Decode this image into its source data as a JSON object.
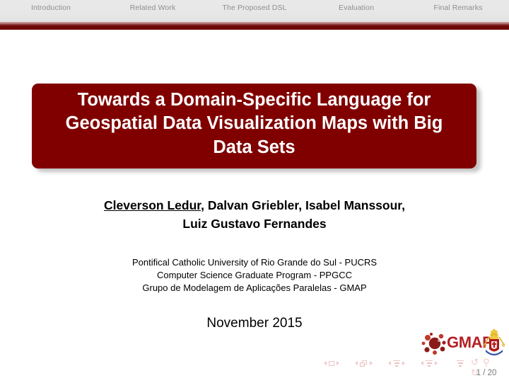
{
  "header": {
    "nav_items": [
      {
        "label": "Introduction"
      },
      {
        "label": "Related Work"
      },
      {
        "label": "The Proposed DSL"
      },
      {
        "label": "Evaluation"
      },
      {
        "label": "Final Remarks"
      }
    ],
    "accent_color": "#6d0606",
    "bar_background": "#e7e7e7",
    "nav_text_color": "#8e8e8e"
  },
  "slide": {
    "title": "Towards a Domain-Specific Language for Geospatial Data Visualization Maps with Big Data Sets",
    "title_box_color": "#800000",
    "title_text_color": "#ffffff",
    "authors": {
      "presenter": "Cleverson Ledur",
      "line1_rest": ", Dalvan Griebler, Isabel Manssour,",
      "line2": "Luiz Gustavo Fernandes"
    },
    "affiliation": [
      "Pontifical Catholic University of Rio Grande do Sul - PUCRS",
      "Computer Science Graduate Program - PPGCC",
      "Grupo de Modelagem de Aplicações Paralelas - GMAP"
    ],
    "date": "November 2015"
  },
  "logo": {
    "name": "GMAP",
    "text_color": "#b41f24",
    "blob_icon": "gmap-cluster-icon",
    "crest_icon": "pucrs-crest-icon"
  },
  "footer": {
    "page_indicator": "1 / 20",
    "nav_symbols": [
      {
        "name": "slide-navigation",
        "icon": "square-icon"
      },
      {
        "name": "frame-navigation",
        "icon": "stacked-squares-icon"
      },
      {
        "name": "subsection-navigation",
        "icon": "lines-icon"
      },
      {
        "name": "section-navigation",
        "icon": "lines-icon"
      },
      {
        "name": "presentation-navigation",
        "icon": "lines-icon"
      }
    ],
    "circle_symbols": "↺ ⚲ ↻",
    "symbol_color": "#f0c9c9"
  }
}
